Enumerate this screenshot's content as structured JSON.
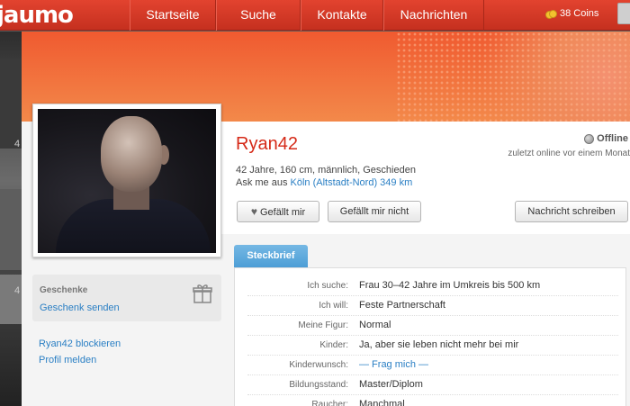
{
  "app": {
    "logo": "jaumo"
  },
  "nav": {
    "items": [
      {
        "label": "Startseite"
      },
      {
        "label": "Suche"
      },
      {
        "label": "Kontakte"
      },
      {
        "label": "Nachrichten"
      }
    ],
    "coins": "38 Coins"
  },
  "background": {
    "numbers": [
      "4",
      "4"
    ]
  },
  "profile": {
    "name": "Ryan42",
    "status": "Offline",
    "last_online": "zuletzt online vor einem Monat",
    "details": "42 Jahre, 160 cm, männlich, Geschieden",
    "location_prefix": "Ask me aus",
    "location_link": "Köln (Altstadt-Nord) 349 km"
  },
  "actions": {
    "like": "Gefällt mir",
    "dislike": "Gefällt mir nicht",
    "message": "Nachricht schreiben"
  },
  "sidebar": {
    "gifts_title": "Geschenke",
    "gifts_send": "Geschenk senden",
    "block": "Ryan42 blockieren",
    "report": "Profil melden"
  },
  "profile_card": {
    "tab": "Steckbrief",
    "rows": [
      {
        "key": "Ich suche:",
        "value": "Frau 30–42 Jahre im Umkreis bis 500 km"
      },
      {
        "key": "Ich will:",
        "value": "Feste Partnerschaft"
      },
      {
        "key": "Meine Figur:",
        "value": "Normal"
      },
      {
        "key": "Kinder:",
        "value": "Ja, aber sie leben nicht mehr bei mir"
      },
      {
        "key": "Kinderwunsch:",
        "value": "— Frag mich —"
      },
      {
        "key": "Bildungsstand:",
        "value": "Master/Diplom"
      },
      {
        "key": "Raucher:",
        "value": "Manchmal"
      }
    ]
  },
  "colors": {
    "brand": "#d52a18",
    "link": "#2a7fc4",
    "tab": "#4d9ed6"
  }
}
